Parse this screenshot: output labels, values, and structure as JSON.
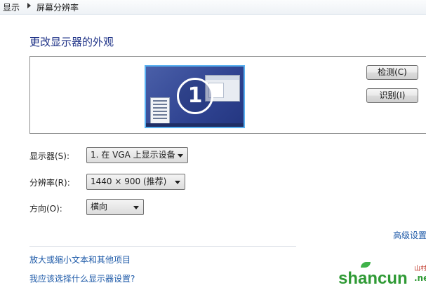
{
  "breadcrumb": [
    "显示",
    "屏幕分辨率"
  ],
  "page_title": "更改显示器的外观",
  "monitor": {
    "number": "1"
  },
  "buttons": {
    "detect": "检测(C)",
    "identify": "识别(I)"
  },
  "settings": {
    "display_label": "显示器(S):",
    "display_value": "1. 在 VGA 上显示设备",
    "resolution_label": "分辨率(R):",
    "resolution_value": "1440 × 900 (推荐)",
    "orientation_label": "方向(O):",
    "orientation_value": "横向"
  },
  "advanced_link": "高级设置",
  "links": [
    "放大或缩小文本和其他项目",
    "我应该选择什么显示器设置?"
  ],
  "watermark": {
    "text": "shancun",
    "sub": "山村网",
    "tld": ".net"
  },
  "colors": {
    "title": "#1e3287",
    "link": "#1e5aa8",
    "monitor_border": "#5ab1f0",
    "watermark": "#2f9a35"
  }
}
